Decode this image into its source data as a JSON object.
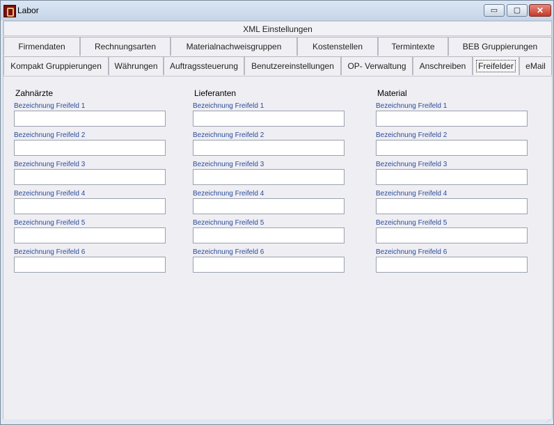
{
  "window": {
    "title": "Labor"
  },
  "titlebar_buttons": {
    "minimize": "▭",
    "maximize": "▢",
    "close": "✕"
  },
  "tabs_row1": [
    "XML Einstellungen"
  ],
  "tabs_row2": [
    "Firmendaten",
    "Rechnungsarten",
    "Materialnachweisgruppen",
    "Kostenstellen",
    "Termintexte",
    "BEB Gruppierungen"
  ],
  "tabs_row3": [
    "Kompakt Gruppierungen",
    "Währungen",
    "Auftragssteuerung",
    "Benutzereinstellungen",
    "OP- Verwaltung",
    "Anschreiben",
    "Freifelder",
    "eMail"
  ],
  "active_tab": "Freifelder",
  "columns": [
    {
      "title": "Zahnärzte",
      "fields": [
        {
          "label": "Bezeichnung Freifeld 1",
          "value": ""
        },
        {
          "label": "Bezeichnung Freifeld 2",
          "value": ""
        },
        {
          "label": "Bezeichnung Freifeld 3",
          "value": ""
        },
        {
          "label": "Bezeichnung Freifeld 4",
          "value": ""
        },
        {
          "label": "Bezeichnung Freifeld 5",
          "value": ""
        },
        {
          "label": "Bezeichnung Freifeld 6",
          "value": ""
        }
      ]
    },
    {
      "title": "Lieferanten",
      "fields": [
        {
          "label": "Bezeichnung Freifeld 1",
          "value": ""
        },
        {
          "label": "Bezeichnung Freifeld 2",
          "value": ""
        },
        {
          "label": "Bezeichnung Freifeld 3",
          "value": ""
        },
        {
          "label": "Bezeichnung Freifeld 4",
          "value": ""
        },
        {
          "label": "Bezeichnung Freifeld 5",
          "value": ""
        },
        {
          "label": "Bezeichnung Freifeld 6",
          "value": ""
        }
      ]
    },
    {
      "title": "Material",
      "fields": [
        {
          "label": "Bezeichnung Freifeld 1",
          "value": ""
        },
        {
          "label": "Bezeichnung Freifeld 2",
          "value": ""
        },
        {
          "label": "Bezeichnung Freifeld 3",
          "value": ""
        },
        {
          "label": "Bezeichnung Freifeld 4",
          "value": ""
        },
        {
          "label": "Bezeichnung Freifeld 5",
          "value": ""
        },
        {
          "label": "Bezeichnung Freifeld 6",
          "value": ""
        }
      ]
    }
  ]
}
